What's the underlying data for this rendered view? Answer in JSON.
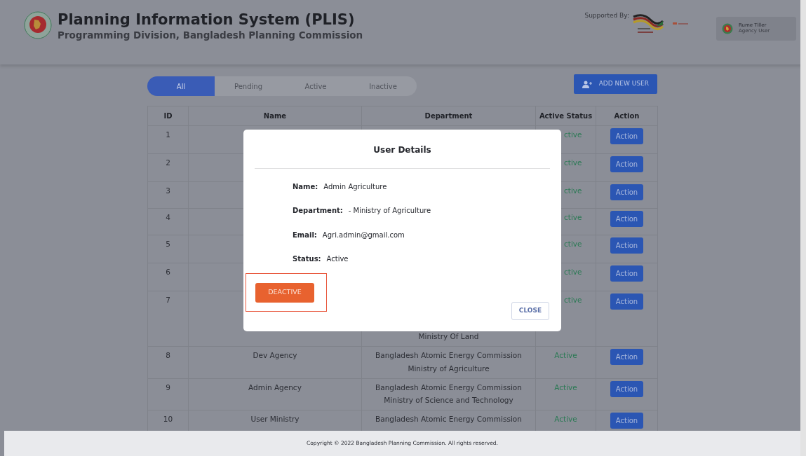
{
  "header": {
    "title": "Planning Information System (PLIS)",
    "subtitle": "Programming Division, Bangladesh Planning Commission",
    "supported_by": "Supported By:",
    "user": {
      "name": "Rume Tiller",
      "role": "Agency User"
    }
  },
  "filter_tabs": [
    {
      "label": "All",
      "selected": true
    },
    {
      "label": "Pending",
      "selected": false
    },
    {
      "label": "Active",
      "selected": false
    },
    {
      "label": "Inactive",
      "selected": false
    }
  ],
  "add_button": "ADD NEW USER",
  "table": {
    "columns": [
      "ID",
      "Name",
      "Department",
      "Active Status",
      "Action"
    ],
    "rows": [
      {
        "id": "1",
        "status": "ctive",
        "action": "Action"
      },
      {
        "id": "2",
        "status": "ctive",
        "action": "Action"
      },
      {
        "id": "3",
        "status": "ctive",
        "action": "Action"
      },
      {
        "id": "4",
        "status": "ctive",
        "action": "Action"
      },
      {
        "id": "5",
        "status": "ctive",
        "action": "Action"
      },
      {
        "id": "6",
        "status": "ctive",
        "action": "Action"
      },
      {
        "id": "7",
        "department": [
          "Ministry Of Land"
        ],
        "status": "ctive",
        "action": "Action"
      },
      {
        "id": "8",
        "name": "Dev Agency",
        "department": [
          "Bangladesh Atomic Energy Commission",
          "Ministry of Agriculture"
        ],
        "status": "Active",
        "action": "Action"
      },
      {
        "id": "9",
        "name": "Admin Agency",
        "department": [
          "Bangladesh Atomic Energy Commission",
          "Ministry of Science and Technology"
        ],
        "status": "Active",
        "action": "Action"
      },
      {
        "id": "10",
        "name": "User Ministry",
        "department": [
          "Bangladesh Atomic Energy Commission"
        ],
        "status": "Active",
        "action": "Action"
      }
    ]
  },
  "modal": {
    "title": "User Details",
    "fields": [
      {
        "label": "Name:",
        "value": "Admin Agriculture"
      },
      {
        "label": "Department:",
        "value": "- Ministry of Agriculture"
      },
      {
        "label": "Email:",
        "value": "Agri.admin@gmail.com"
      },
      {
        "label": "Status:",
        "value": "Active"
      }
    ],
    "deactivate_button": "DEACTIVE",
    "close_button": "CLOSE"
  },
  "footer": "Copyright © 2022 Bangladesh Planning Commission. All rights reserved."
}
